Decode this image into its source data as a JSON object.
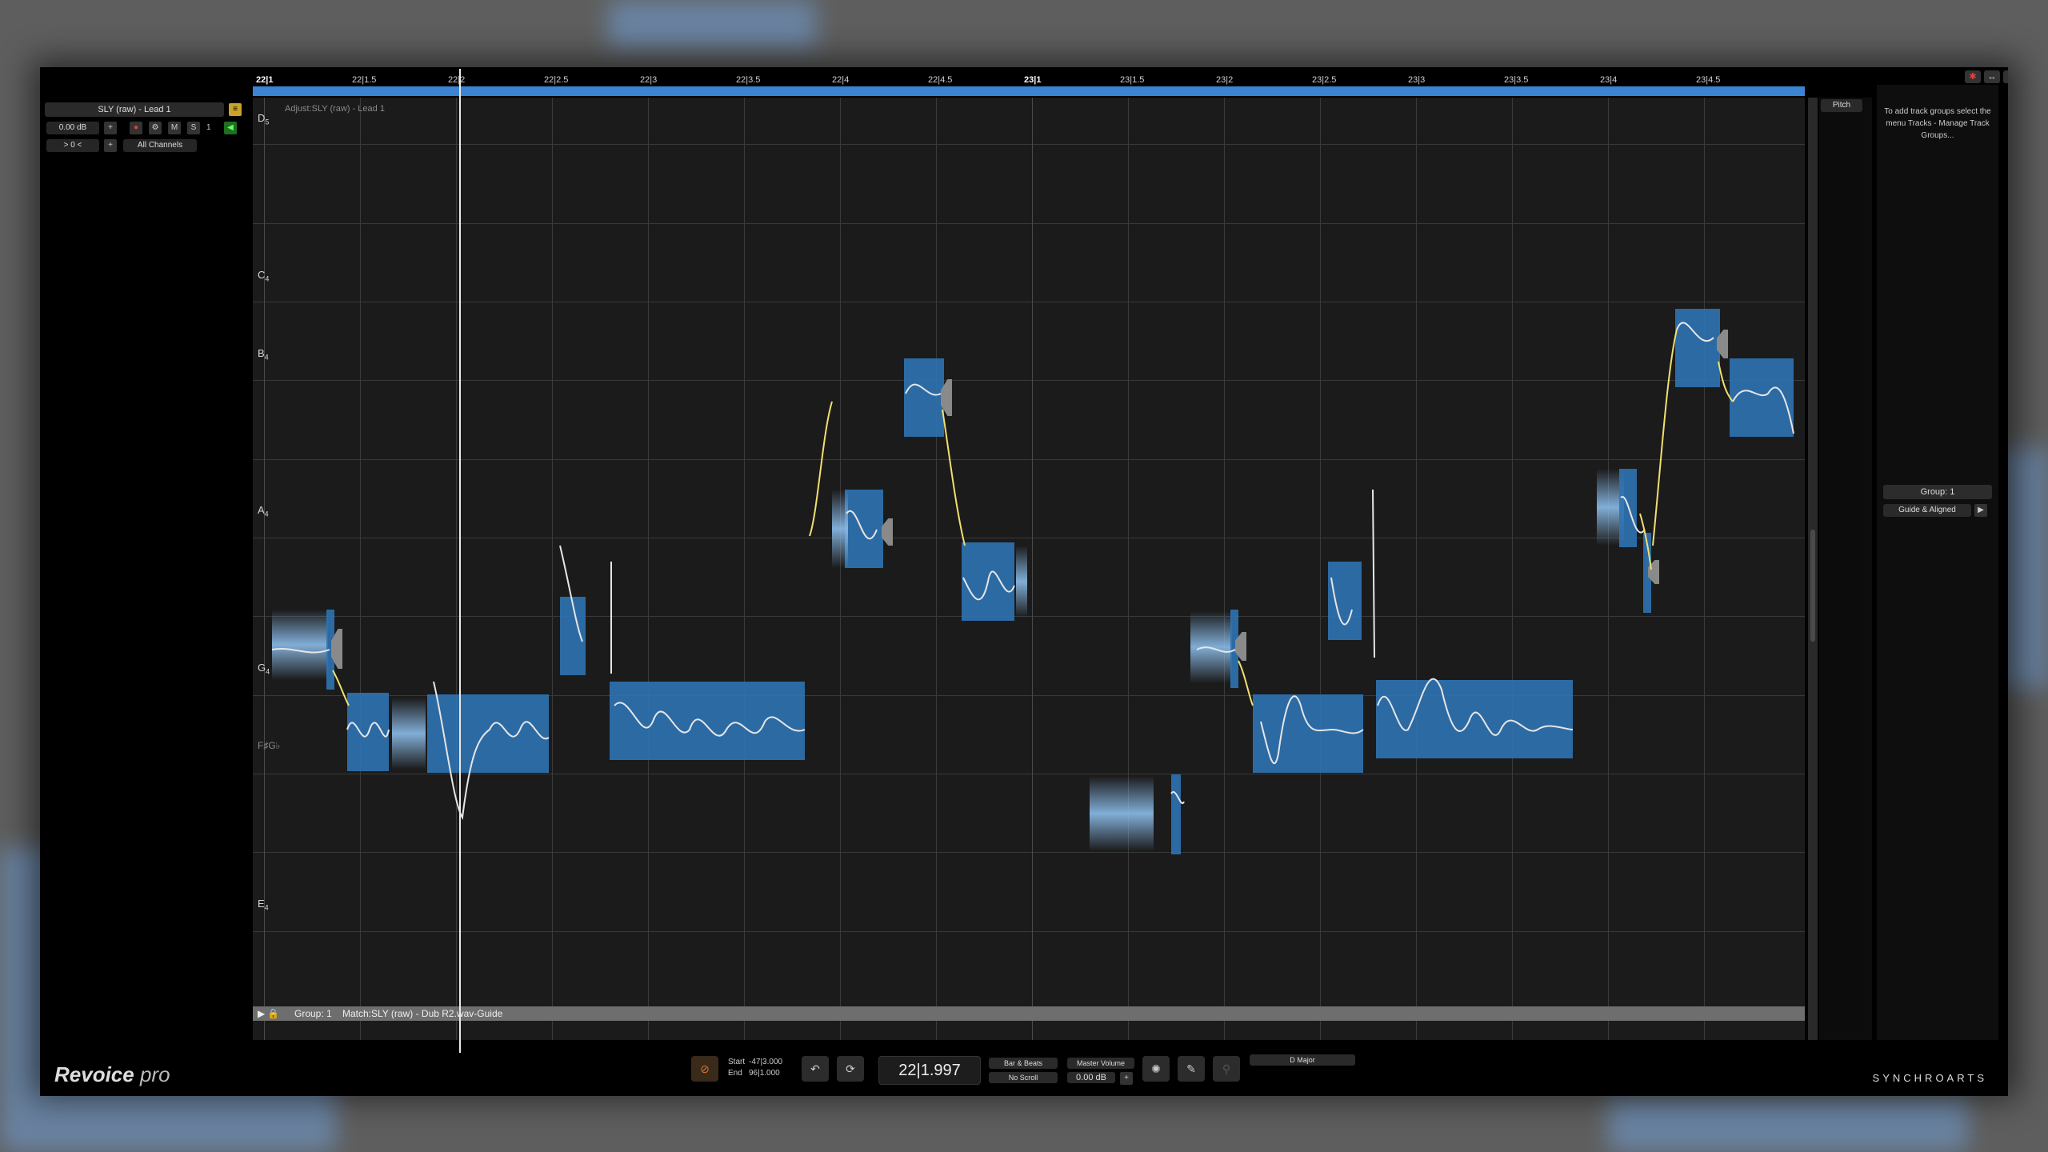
{
  "track": {
    "name": "SLY (raw) - Lead 1",
    "volume": "0.00 dB",
    "offset": "> 0 <",
    "channels": "All Channels",
    "mute": "M",
    "solo": "S",
    "number": "1"
  },
  "ruler": {
    "ticks": [
      "22|1",
      "22|1.5",
      "22|2",
      "22|2.5",
      "22|3",
      "22|3.5",
      "22|4",
      "22|4.5",
      "23|1",
      "23|1.5",
      "23|2",
      "23|2.5",
      "23|3",
      "23|3.5",
      "23|4",
      "23|4.5"
    ]
  },
  "lanes": {
    "adjust_label": "Adjust:SLY (raw) - Lead 1",
    "group_label": "Group: 1",
    "match_label": "Match:SLY (raw) - Dub R2.wav-Guide"
  },
  "notes": [
    {
      "name": "D",
      "octave": "5"
    },
    {
      "name": "C",
      "octave": "4"
    },
    {
      "name": "B",
      "octave": "4"
    },
    {
      "name": "A",
      "octave": "4"
    },
    {
      "name": "G",
      "octave": "4"
    },
    {
      "name": "F♯G♭",
      "octave": ""
    },
    {
      "name": "E",
      "octave": "4"
    }
  ],
  "right_panel": {
    "pitch_button": "Pitch",
    "hint": "To add track groups select the menu Tracks - Manage Track Groups...",
    "group": "Group: 1",
    "mode": "Guide & Aligned"
  },
  "toolbar": {
    "logo_main": "Revoice",
    "logo_sub": "pro",
    "start_label": "Start",
    "start_value": "-47|3.000",
    "end_label": "End",
    "end_value": "96|1.000",
    "time": "22|1.997",
    "bar_beats": "Bar & Beats",
    "no_scroll": "No Scroll",
    "master_volume": "Master Volume",
    "master_db": "0.00 dB",
    "key": "D Major",
    "brand": "SYNCHROARTS"
  },
  "colors": {
    "accent_blue": "#3b84d4",
    "note_block": "#2f73b4",
    "pitch_curve": "#f0e070"
  }
}
